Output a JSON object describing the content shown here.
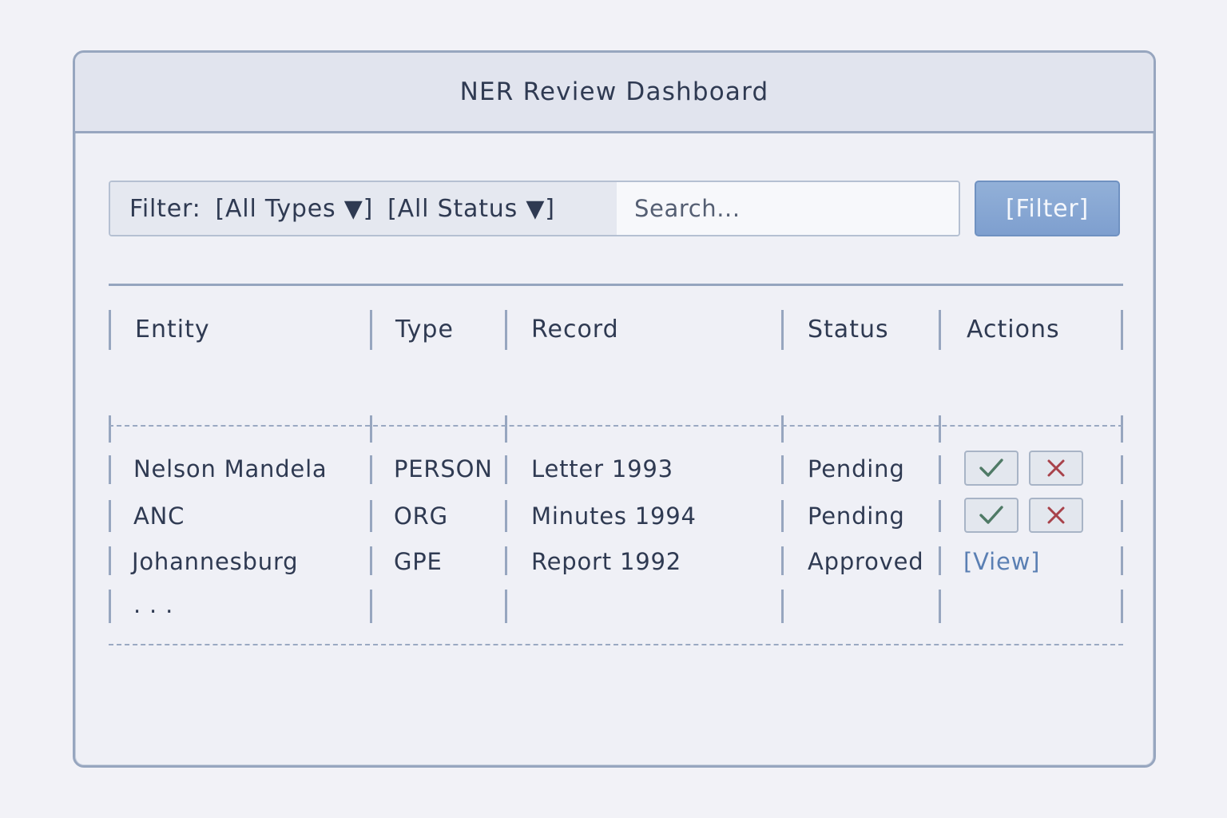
{
  "window": {
    "title": "NER Review Dashboard"
  },
  "filter": {
    "label": "Filter:",
    "type_dropdown": "[All Types ▼]",
    "status_dropdown": "[All Status ▼]",
    "search_placeholder": "Search...",
    "button_label": "[Filter]"
  },
  "table": {
    "headers": [
      "Entity",
      "Type",
      "Record",
      "Status",
      "Actions"
    ],
    "rows": [
      {
        "entity": "Nelson Mandela",
        "type": "PERSON",
        "record": "Letter 1993",
        "status": "Pending"
      },
      {
        "entity": "ANC",
        "type": "ORG",
        "record": "Minutes 1994",
        "status": "Pending"
      },
      {
        "entity": "Johannesburg",
        "type": "GPE",
        "record": "Report 1992",
        "status": "Approved",
        "view_label": "[View]"
      }
    ],
    "more_indicator": ". . ."
  },
  "icons": {
    "approve": "check-icon",
    "reject": "close-icon"
  },
  "colors": {
    "accent": "#7e9fcf",
    "approve": "#4f7a66",
    "reject": "#a8424a",
    "link": "#5a7fb3"
  }
}
